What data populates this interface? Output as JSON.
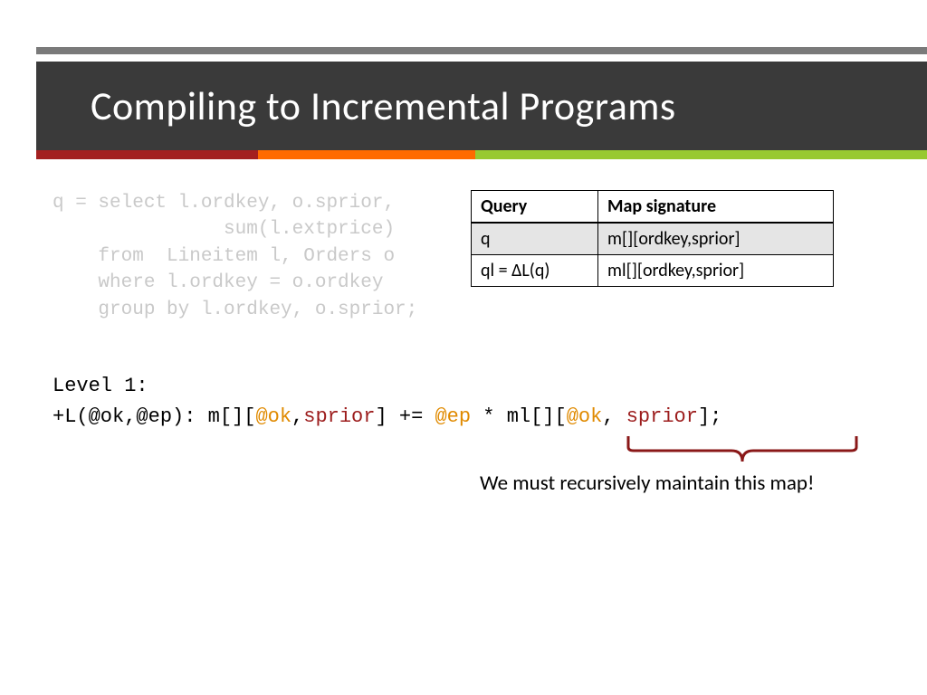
{
  "header": {
    "title": "Compiling to Incremental Programs"
  },
  "sql": {
    "line1": "q = select l.ordkey, o.sprior,",
    "line2": "               sum(l.extprice)",
    "line3": "    from  Lineitem l, Orders o",
    "line4": "    where l.ordkey = o.ordkey",
    "line5": "    group by l.ordkey, o.sprior;"
  },
  "table": {
    "headers": {
      "c0": "Query",
      "c1": "Map signature"
    },
    "rows": [
      {
        "c0": "q",
        "c1": "m[][ordkey,sprior]"
      },
      {
        "c0": "ql = ΔL(q)",
        "c1": "ml[][ordkey,sprior]"
      }
    ]
  },
  "code": {
    "level_label": "Level 1:",
    "pieces": {
      "p1": "+L(@ok,@ep): m[][",
      "ok1": "@ok",
      "comma1": ",",
      "sprior1": "sprior",
      "p2": "] += ",
      "ep": "@ep",
      "p3": " * ml[][",
      "ok2": "@ok",
      "comma2": ", ",
      "sprior2": "sprior",
      "p4": "];"
    }
  },
  "caption": "We must recursively maintain this map!"
}
